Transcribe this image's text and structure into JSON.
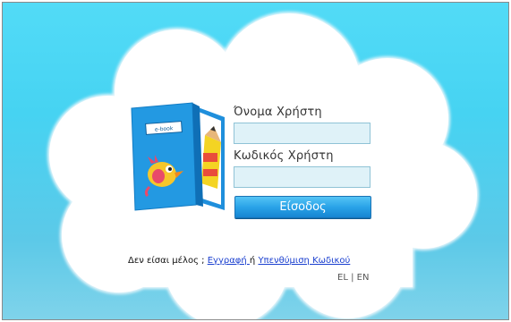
{
  "login": {
    "username_label": "Όνομα Χρήστη",
    "password_label": "Κωδικός Χρήστη",
    "username_value": "",
    "password_value": "",
    "submit_label": "Είσοδος"
  },
  "footer": {
    "not_member": "Δεν είσαι μέλος ; ",
    "register_link": "Εγγραφή ",
    "or": "ή ",
    "reminder_link": "Υπενθύμιση Κωδικού"
  },
  "language": {
    "el": "EL",
    "separator": " | ",
    "en": "EN"
  },
  "brand": {
    "book_logo_text": "e-book"
  },
  "colors": {
    "sky_top": "#52dbf7",
    "sky_bottom": "#7fd3ea",
    "cloud": "#ffffff",
    "button": "#2aa3e8",
    "field_bg": "#dff2f8"
  }
}
